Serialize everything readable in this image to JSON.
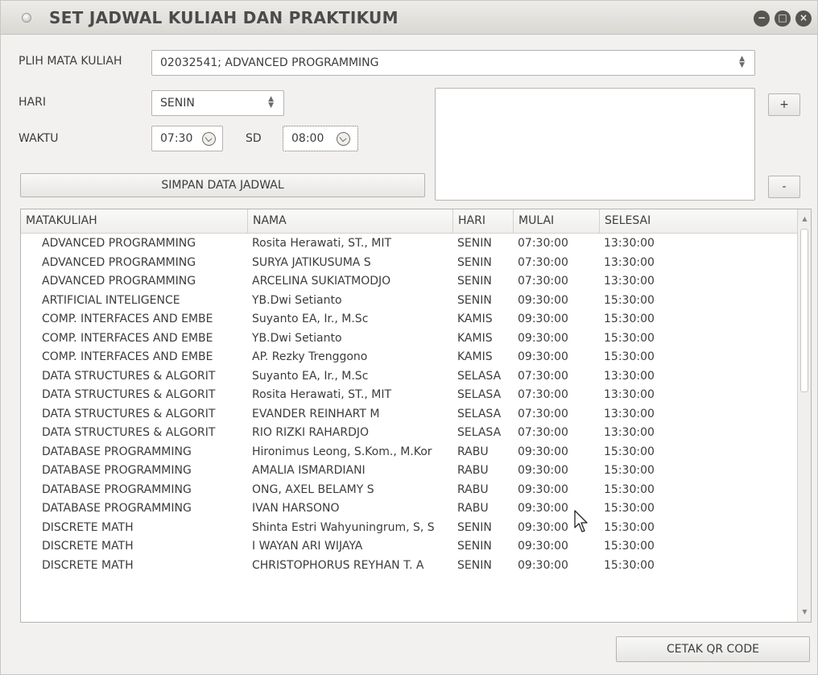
{
  "window": {
    "title": "SET JADWAL KULIAH DAN PRAKTIKUM",
    "controls": {
      "minimize": "−",
      "maximize": "□",
      "close": "×"
    }
  },
  "form": {
    "course_label": "PLIH MATA KULIAH",
    "course_value": "02032541; ADVANCED PROGRAMMING",
    "day_label": "HARI",
    "day_value": "SENIN",
    "time_label": "WAKTU",
    "time_start": "07:30",
    "sd_label": "SD",
    "time_end": "08:00",
    "save_button": "SIMPAN DATA JADWAL",
    "add_button": "+",
    "remove_button": "-",
    "schedule_list": ""
  },
  "table": {
    "columns": [
      "MATAKULIAH",
      "NAMA",
      "HARI",
      "MULAI",
      "SELESAI"
    ],
    "rows": [
      [
        "ADVANCED PROGRAMMING",
        "Rosita Herawati, ST., MIT",
        "SENIN",
        "07:30:00",
        "13:30:00"
      ],
      [
        "ADVANCED PROGRAMMING",
        "SURYA JATIKUSUMA S",
        "SENIN",
        "07:30:00",
        "13:30:00"
      ],
      [
        "ADVANCED PROGRAMMING",
        "ARCELINA SUKIATMODJO",
        "SENIN",
        "07:30:00",
        "13:30:00"
      ],
      [
        "ARTIFICIAL INTELIGENCE",
        "YB.Dwi Setianto",
        "SENIN",
        "09:30:00",
        "15:30:00"
      ],
      [
        "COMP. INTERFACES AND EMBE",
        "Suyanto EA, Ir., M.Sc",
        "KAMIS",
        "09:30:00",
        "15:30:00"
      ],
      [
        "COMP. INTERFACES AND EMBE",
        "YB.Dwi Setianto",
        "KAMIS",
        "09:30:00",
        "15:30:00"
      ],
      [
        "COMP. INTERFACES AND EMBE",
        "AP. Rezky Trenggono",
        "KAMIS",
        "09:30:00",
        "15:30:00"
      ],
      [
        "DATA STRUCTURES & ALGORIT",
        "Suyanto EA, Ir., M.Sc",
        "SELASA",
        "07:30:00",
        "13:30:00"
      ],
      [
        "DATA STRUCTURES & ALGORIT",
        "Rosita Herawati, ST., MIT",
        "SELASA",
        "07:30:00",
        "13:30:00"
      ],
      [
        "DATA STRUCTURES & ALGORIT",
        "EVANDER REINHART M",
        "SELASA",
        "07:30:00",
        "13:30:00"
      ],
      [
        "DATA STRUCTURES & ALGORIT",
        "RIO RIZKI RAHARDJO",
        "SELASA",
        "07:30:00",
        "13:30:00"
      ],
      [
        "DATABASE PROGRAMMING",
        "Hironimus Leong, S.Kom., M.Kor",
        "RABU",
        "09:30:00",
        "15:30:00"
      ],
      [
        "DATABASE PROGRAMMING",
        "AMALIA ISMARDIANI",
        "RABU",
        "09:30:00",
        "15:30:00"
      ],
      [
        "DATABASE PROGRAMMING",
        "ONG, AXEL BELAMY S",
        "RABU",
        "09:30:00",
        "15:30:00"
      ],
      [
        "DATABASE PROGRAMMING",
        "IVAN HARSONO",
        "RABU",
        "09:30:00",
        "15:30:00"
      ],
      [
        "DISCRETE MATH",
        "Shinta Estri Wahyuningrum, S, S",
        "SENIN",
        "09:30:00",
        "15:30:00"
      ],
      [
        "DISCRETE MATH",
        "I WAYAN ARI WIJAYA",
        "SENIN",
        "09:30:00",
        "15:30:00"
      ],
      [
        "DISCRETE MATH",
        "CHRISTOPHORUS REYHAN T. A",
        "SENIN",
        "09:30:00",
        "15:30:00"
      ]
    ]
  },
  "print_button": "CETAK QR CODE"
}
